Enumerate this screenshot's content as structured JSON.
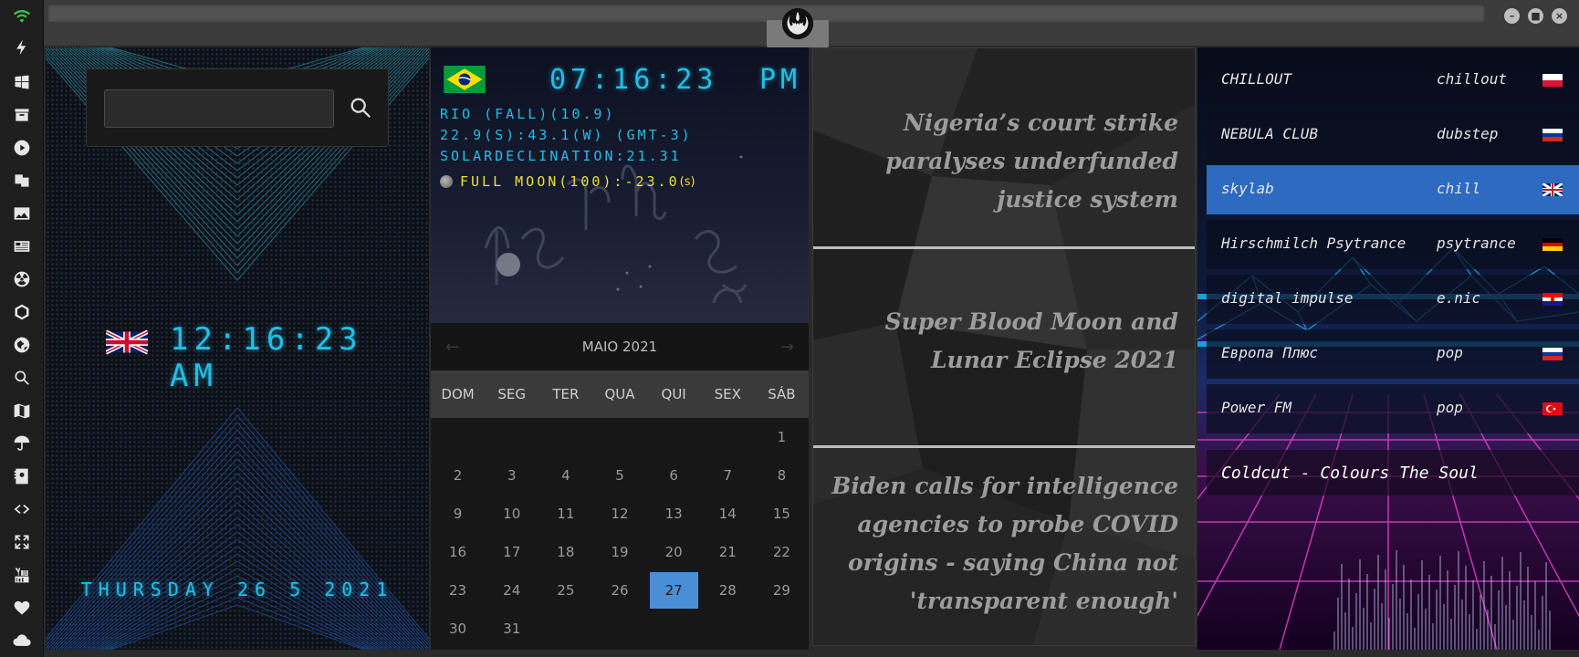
{
  "sidebar": {
    "icons": [
      "wifi-icon",
      "bolt-icon",
      "windows-icon",
      "archive-icon",
      "play-icon",
      "translate-icon",
      "image-icon",
      "news-icon",
      "radiation-icon",
      "hexagon-icon",
      "globe-icon",
      "search-icon",
      "map-icon",
      "umbrella-icon",
      "contacts-icon",
      "code-icon",
      "expand-icon",
      "youtube-icon",
      "heart-icon",
      "cloud-icon"
    ]
  },
  "titlebar": {
    "emblem": "rebel-alliance-icon",
    "buttons": {
      "minimize": "–",
      "maximize": "■",
      "close": "×"
    }
  },
  "colors": {
    "accent": "#22bfe8",
    "moon_text": "#e8e037",
    "today": "#4a8fd6",
    "active_station": "#2d6ac0"
  },
  "world_clock": {
    "search": {
      "value": "",
      "icon": "search-icon"
    },
    "flag": "uk-flag",
    "time": "12:16:23 AM",
    "date": "THURSDAY 26 5 2021"
  },
  "local_clock": {
    "flag": "brazil-flag",
    "time": "07:16:23",
    "ampm": "PM",
    "line1": "RIO (FALL)(10.9)",
    "line2": "22.9(S):43.1(W) (GMT-3)",
    "line3": "SOLARDECLINATION:21.31",
    "moon": "FULL MOON(100):-23.0",
    "moon_unit": "(s)"
  },
  "calendar": {
    "month": "MAIO 2021",
    "prev": "←",
    "next": "→",
    "weekdays": [
      "DOM",
      "SEG",
      "TER",
      "QUA",
      "QUI",
      "SEX",
      "SÁB"
    ],
    "weeks": [
      [
        "",
        "",
        "",
        "",
        "",
        "",
        "1"
      ],
      [
        "2",
        "3",
        "4",
        "5",
        "6",
        "7",
        "8"
      ],
      [
        "9",
        "10",
        "11",
        "12",
        "13",
        "14",
        "15"
      ],
      [
        "16",
        "17",
        "18",
        "19",
        "20",
        "21",
        "22"
      ],
      [
        "23",
        "24",
        "25",
        "26",
        "27",
        "28",
        "29"
      ],
      [
        "30",
        "31",
        "",
        "",
        "",
        "",
        ""
      ]
    ],
    "today": "27"
  },
  "news": [
    "Nigeria’s court strike paralyses underfunded justice system",
    "Super Blood Moon and Lunar Eclipse 2021",
    "Biden calls for intelligence agencies to probe COVID origins - saying China not 'transparent enough'"
  ],
  "radio": {
    "stations": [
      {
        "name": "CHILLOUT",
        "genre": "chillout",
        "flag": "poland"
      },
      {
        "name": "NEBULA CLUB",
        "genre": "dubstep",
        "flag": "russia"
      },
      {
        "name": "skylab",
        "genre": "chill",
        "flag": "uk"
      },
      {
        "name": "Hirschmilch Psytrance",
        "genre": "psytrance",
        "flag": "germany"
      },
      {
        "name": "digital impulse",
        "genre": "e.nic",
        "flag": "croatia"
      },
      {
        "name": "Европа Плюс",
        "genre": "pop",
        "flag": "russia"
      },
      {
        "name": "Power FM",
        "genre": "pop",
        "flag": "turkey"
      }
    ],
    "active": 2,
    "now_playing": "Coldcut - Colours The Soul"
  }
}
